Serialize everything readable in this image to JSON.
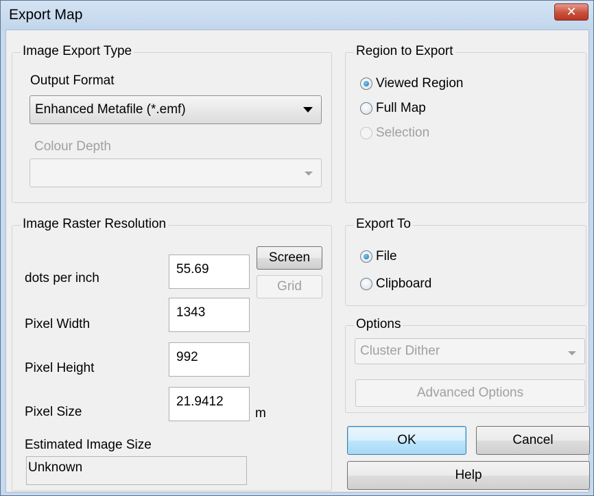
{
  "window": {
    "title": "Export Map",
    "close_label": "✕"
  },
  "image_export_type": {
    "legend": "Image Export Type",
    "output_format_label": "Output Format",
    "output_format_value": "Enhanced Metafile (*.emf)",
    "colour_depth_label": "Colour Depth",
    "colour_depth_value": ""
  },
  "region_to_export": {
    "legend": "Region to Export",
    "options": [
      {
        "label": "Viewed Region",
        "selected": true,
        "enabled": true
      },
      {
        "label": "Full Map",
        "selected": false,
        "enabled": true
      },
      {
        "label": "Selection",
        "selected": false,
        "enabled": false
      }
    ]
  },
  "raster_resolution": {
    "legend": "Image Raster Resolution",
    "dpi_label": "dots per inch",
    "dpi_value": "55.69",
    "screen_button": "Screen",
    "grid_button": "Grid",
    "pixel_width_label": "Pixel Width",
    "pixel_width_value": "1343",
    "pixel_height_label": "Pixel Height",
    "pixel_height_value": "992",
    "pixel_size_label": "Pixel Size",
    "pixel_size_value": "21.9412",
    "pixel_size_unit": "m",
    "estimated_size_label": "Estimated Image Size",
    "estimated_size_value": "Unknown"
  },
  "export_to": {
    "legend": "Export To",
    "options": [
      {
        "label": "File",
        "selected": true
      },
      {
        "label": "Clipboard",
        "selected": false
      }
    ]
  },
  "options": {
    "legend": "Options",
    "dither_value": "Cluster Dither",
    "advanced_button": "Advanced Options"
  },
  "buttons": {
    "ok": "OK",
    "cancel": "Cancel",
    "help": "Help"
  }
}
